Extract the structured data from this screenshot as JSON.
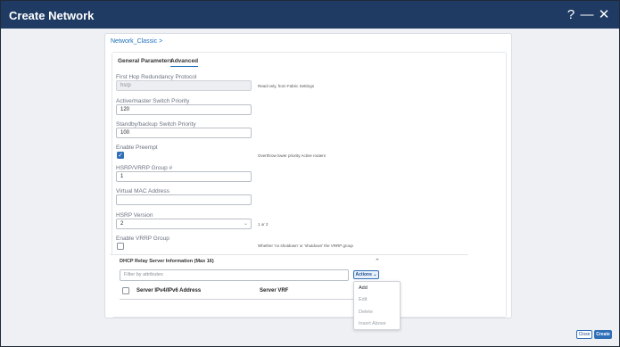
{
  "window": {
    "title": "Create Network",
    "help_icon": "?",
    "minimize_icon": "—",
    "close_icon": "✕"
  },
  "breadcrumb": "Network_Classic >",
  "tabs": [
    {
      "label": "General Parameters",
      "active": false
    },
    {
      "label": "Advanced",
      "active": true
    }
  ],
  "form": {
    "fhrp": {
      "label": "First Hop Redundancy Protocol",
      "value": "hsrp",
      "hint": "Read-only, from Fabric Settings"
    },
    "active_priority": {
      "label": "Active/master Switch Priority",
      "value": "120"
    },
    "standby_priority": {
      "label": "Standby/backup Switch Priority",
      "value": "100"
    },
    "enable_preempt": {
      "label": "Enable Preempt",
      "checked": true,
      "hint": "Overthrow lower priority Active routers"
    },
    "group": {
      "label": "HSRP/VRRP Group #",
      "value": "1"
    },
    "vmac": {
      "label": "Virtual MAC Address",
      "value": ""
    },
    "hsrp_version": {
      "label": "HSRP Version",
      "value": "2",
      "hint": "1 or 2"
    },
    "enable_vrrp": {
      "label": "Enable VRRP Group",
      "checked": false,
      "hint": "Whether 'no shutdown' or 'shutdown' the VRRP group"
    }
  },
  "dhcp": {
    "title": "DHCP Relay Server Information (Max 16)",
    "filter_placeholder": "Filter by attributes",
    "actions_label": "Actions ⌄",
    "columns": [
      "Server IPv4/IPv6 Address",
      "Server VRF"
    ],
    "menu": [
      {
        "label": "Add",
        "enabled": true
      },
      {
        "label": "Edit",
        "enabled": false
      },
      {
        "label": "Delete",
        "enabled": false
      },
      {
        "label": "Insert Above",
        "enabled": false
      }
    ]
  },
  "footer": {
    "close_label": "Close",
    "create_label": "Create"
  }
}
